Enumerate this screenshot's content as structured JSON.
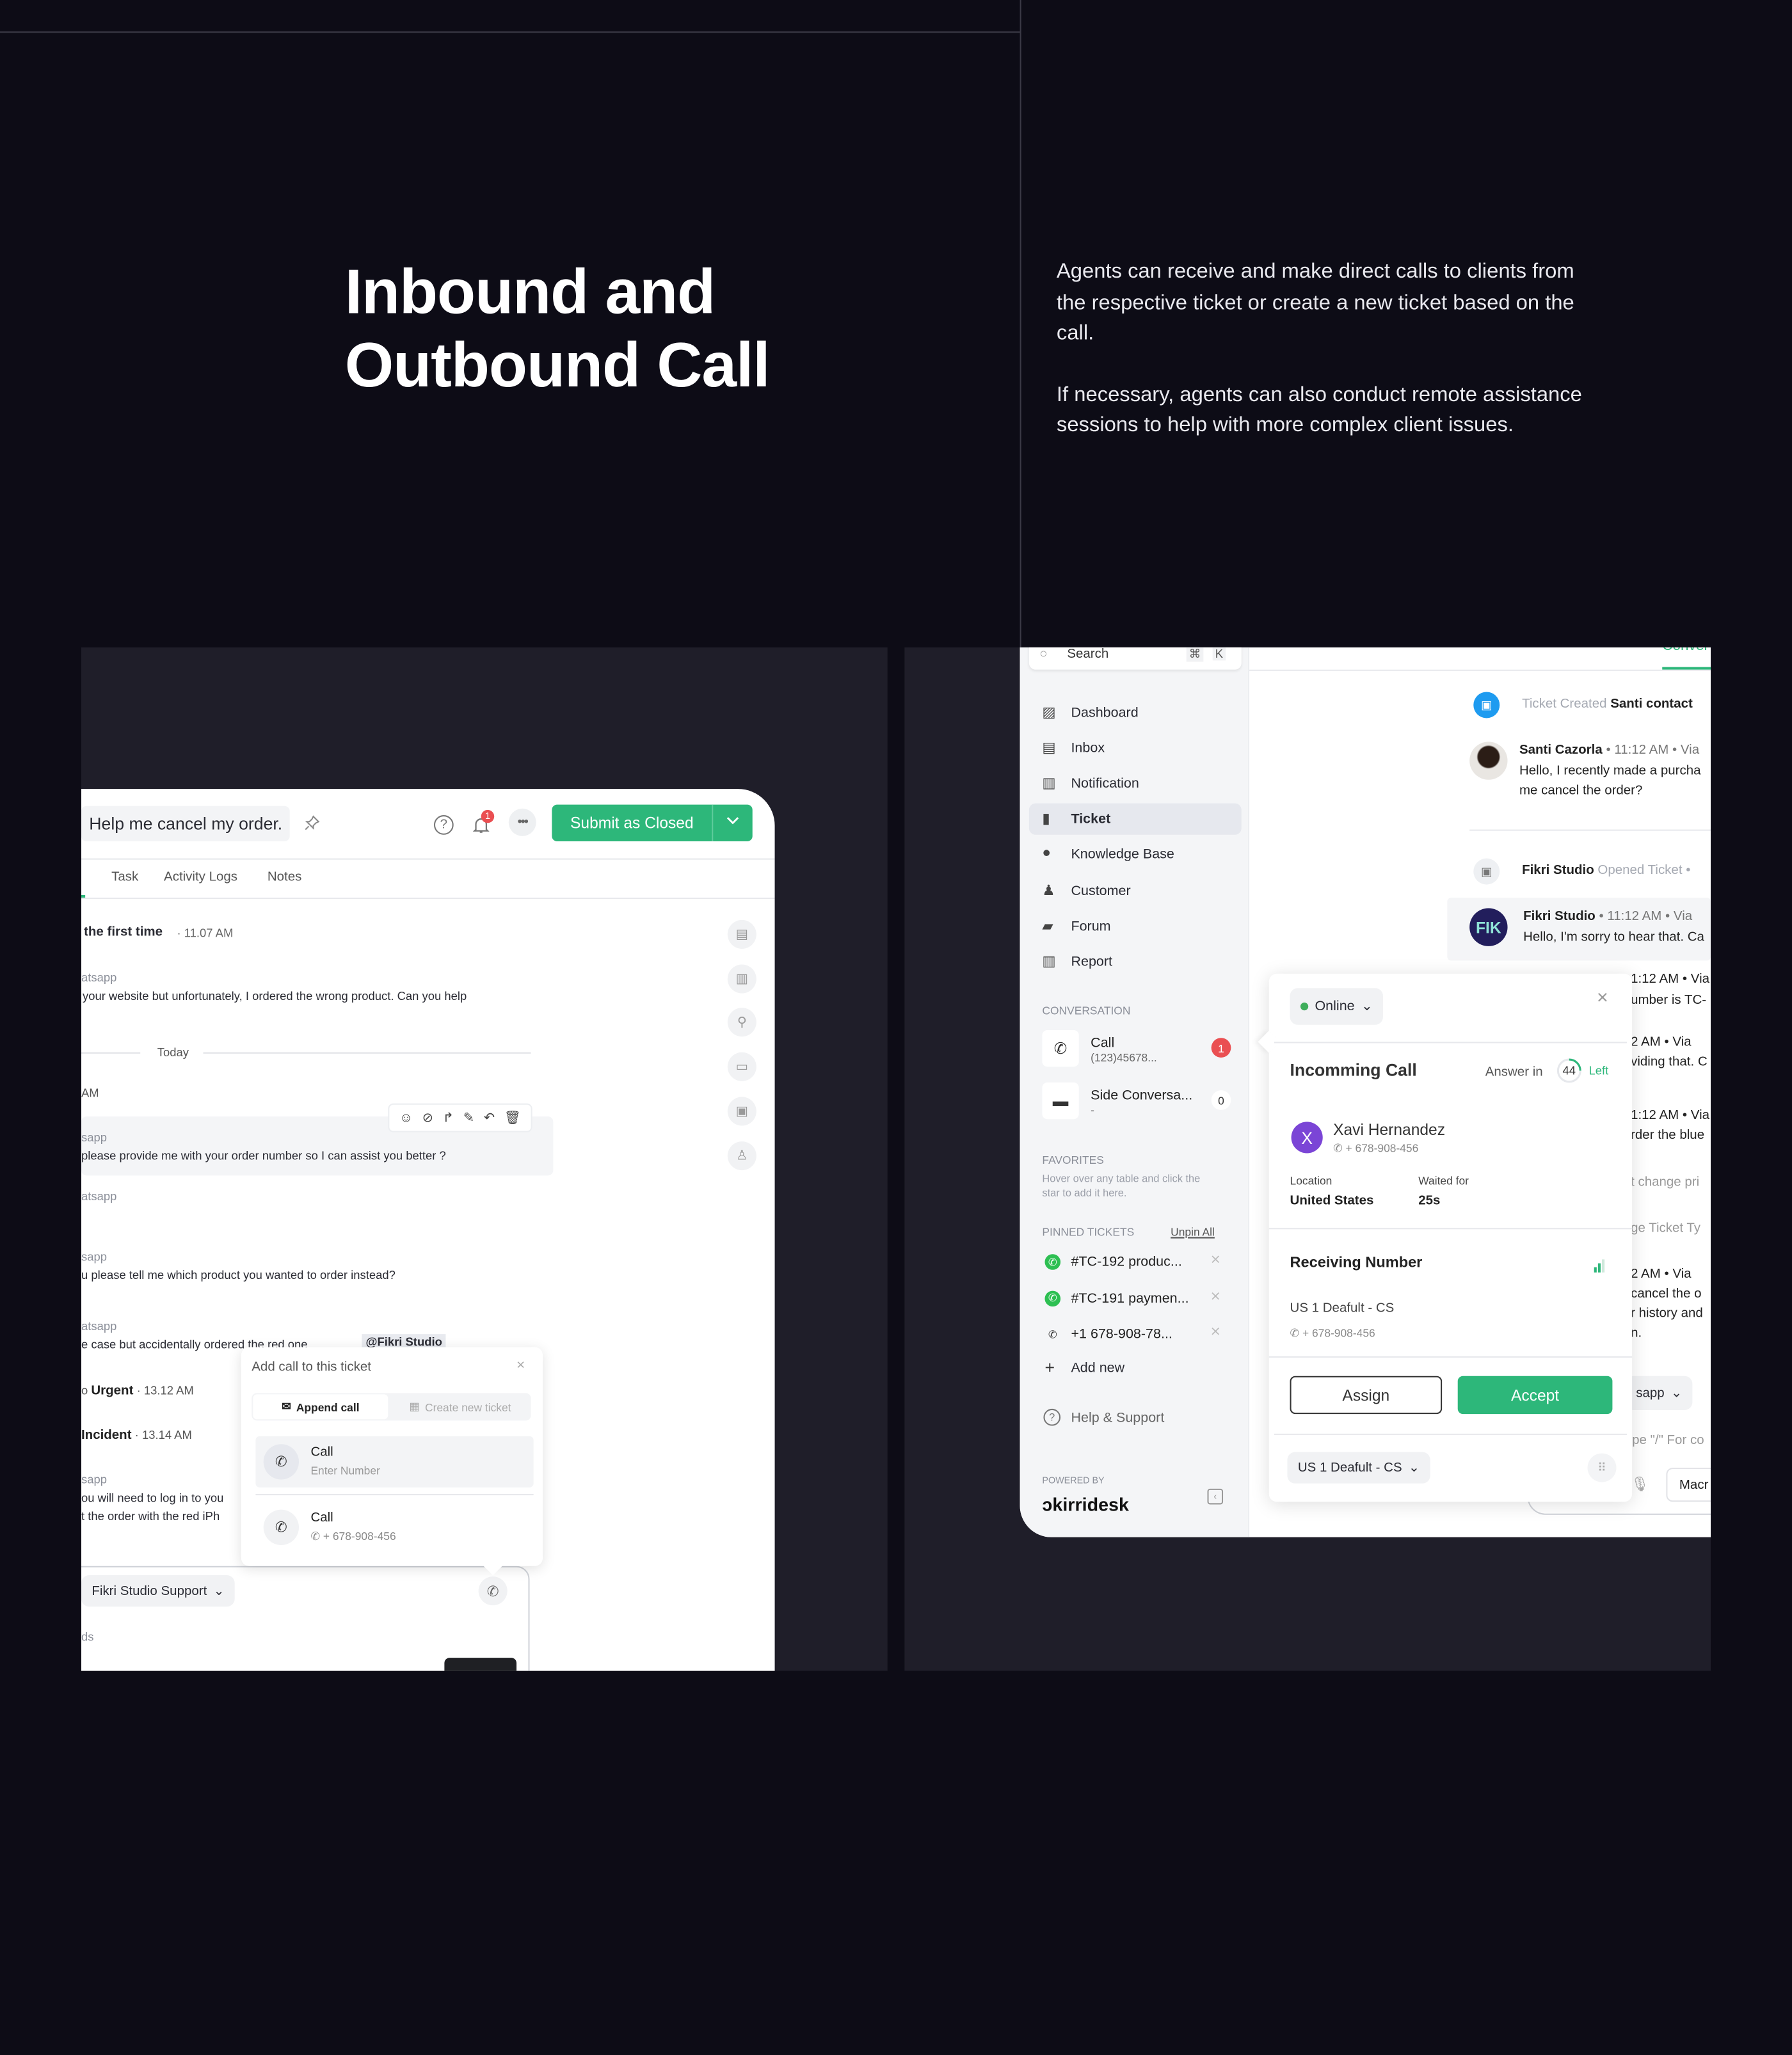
{
  "hero": {
    "title_line1": "Inbound and",
    "title_line2": "Outbound Call",
    "para1": "Agents can receive and make direct calls to clients from the respective ticket or create a new ticket based on the call.",
    "para2": "If necessary, agents can also conduct remote assistance sessions to help with more complex client issues."
  },
  "colors": {
    "background": "#0d0c16",
    "panel": "#1f1e29",
    "accent_green": "#2db77a",
    "badge_red": "#ea4f52",
    "avatar_purple": "#7b45d6",
    "avatar_navy": "#221e5c",
    "ticket_blue": "#1e9bf0"
  },
  "ticket": {
    "title": "Help me cancel my order.",
    "notif_count": "1",
    "submit_label": "Submit as Closed",
    "tabs": [
      "Task",
      "Activity Logs",
      "Notes"
    ],
    "messages": {
      "m1_title": "the first time",
      "m1_time": "· 11.07 AM",
      "m2_via": "atsapp",
      "m2_text": "your website but unfortunately, I ordered the wrong product. Can you help",
      "divider": "Today",
      "m3_time": "AM",
      "m4_via": "sapp",
      "m4_text": "please provide me with your order number so I can assist you better ?",
      "m5_via": "atsapp",
      "m6_via": "sapp",
      "m6_text": "u please tell me which product you wanted to order instead?",
      "m7_via": "atsapp",
      "m7_text": "e case but accidentally ordered the red one",
      "m7_mention": "@Fikri Studio",
      "e1_prefix": "o ",
      "e1_value": "Urgent",
      "e1_time": "· 13.12 AM",
      "e2_value": "Incident",
      "e2_time": "· 13.14 AM",
      "m8_via": "sapp",
      "m8_line1": "ou will need to log in to you",
      "m8_line2": "t the order with the red iPh"
    },
    "composer": {
      "inbox_select": "Fikri Studio Support",
      "hint": "ds"
    },
    "popover": {
      "title": "Add call to this ticket",
      "seg_append": "Append call",
      "seg_create": "Create new ticket",
      "rows": [
        {
          "label": "Call",
          "sub": "Enter Number"
        },
        {
          "label": "Call",
          "sub": "+ 678-908-456"
        }
      ]
    }
  },
  "sidebar": {
    "search_placeholder": "Search",
    "shortcut_cmd": "⌘",
    "shortcut_key": "K",
    "nav": [
      {
        "label": "Dashboard",
        "icon": "dashboard-icon"
      },
      {
        "label": "Inbox",
        "icon": "inbox-icon"
      },
      {
        "label": "Notification",
        "icon": "notification-icon"
      },
      {
        "label": "Ticket",
        "icon": "ticket-icon",
        "active": true
      },
      {
        "label": "Knowledge Base",
        "icon": "bulb-icon"
      },
      {
        "label": "Customer",
        "icon": "users-icon"
      },
      {
        "label": "Forum",
        "icon": "forum-icon"
      },
      {
        "label": "Report",
        "icon": "report-icon"
      }
    ],
    "conversation_heading": "CONVERSATION",
    "conversations": [
      {
        "title": "Call",
        "sub": "(123)45678...",
        "count": "1"
      },
      {
        "title": "Side Conversa...",
        "sub": "-",
        "count": "0"
      }
    ],
    "favorites_heading": "FAVORITES",
    "favorites_hint_1": "Hover over any table and click the",
    "favorites_hint_2": "star to add it here.",
    "pinned_heading": "PINNED TICKETS",
    "unpin_all": "Unpin All",
    "pinned": [
      {
        "label": "#TC-192 produc...",
        "channel": "whatsapp"
      },
      {
        "label": "#TC-191 paymen...",
        "channel": "whatsapp"
      },
      {
        "label": "+1 678-908-78...",
        "channel": "phone"
      }
    ],
    "add_new": "Add new",
    "help": "Help & Support",
    "powered_by": "POWERED BY",
    "brand": "kirridesk"
  },
  "conversation": {
    "tab": "Conver",
    "created_label": "Ticket Created",
    "created_actor": "Santi contact",
    "santi_name": "Santi Cazorla",
    "santi_meta": "• 11:12 AM • Via",
    "santi_line1": "Hello, I recently made a purcha",
    "santi_line2": "me cancel the order?",
    "opened_actor": "Fikri Studio",
    "opened_label": "Opened Ticket •",
    "fikri_avatar": "FIK",
    "fikri_name": "Fikri Studio",
    "fikri_meta": "• 11:12 AM • Via",
    "fikri_text": "Hello, I'm sorry to hear that. Ca",
    "frags": [
      "1:12 AM • Via",
      "umber is TC-",
      "2 AM • Via",
      "viding that. C",
      "1:12 AM • Via",
      "rder the blue",
      "t change pri",
      "ge Ticket Ty",
      "2 AM • Via",
      "cancel the o",
      "r history and",
      "n."
    ],
    "channel_select": "sapp",
    "composer_hint": "pe \"/\" For co",
    "macro": "Macr"
  },
  "call": {
    "status": "Online",
    "title": "Incomming Call",
    "answer_in": "Answer in",
    "seconds_left": "44",
    "left": "Left",
    "caller_initial": "X",
    "caller_name": "Xavi Hernandez",
    "caller_phone": "+ 678-908-456",
    "location_label": "Location",
    "location": "United States",
    "waited_label": "Waited for",
    "waited": "25s",
    "receiving_label": "Receiving Number",
    "receiving_name": "US 1 Deafult - CS",
    "receiving_phone": "+ 678-908-456",
    "assign": "Assign",
    "accept": "Accept",
    "line_select": "US 1 Deafult - CS",
    "countdown_fraction": 0.25
  }
}
